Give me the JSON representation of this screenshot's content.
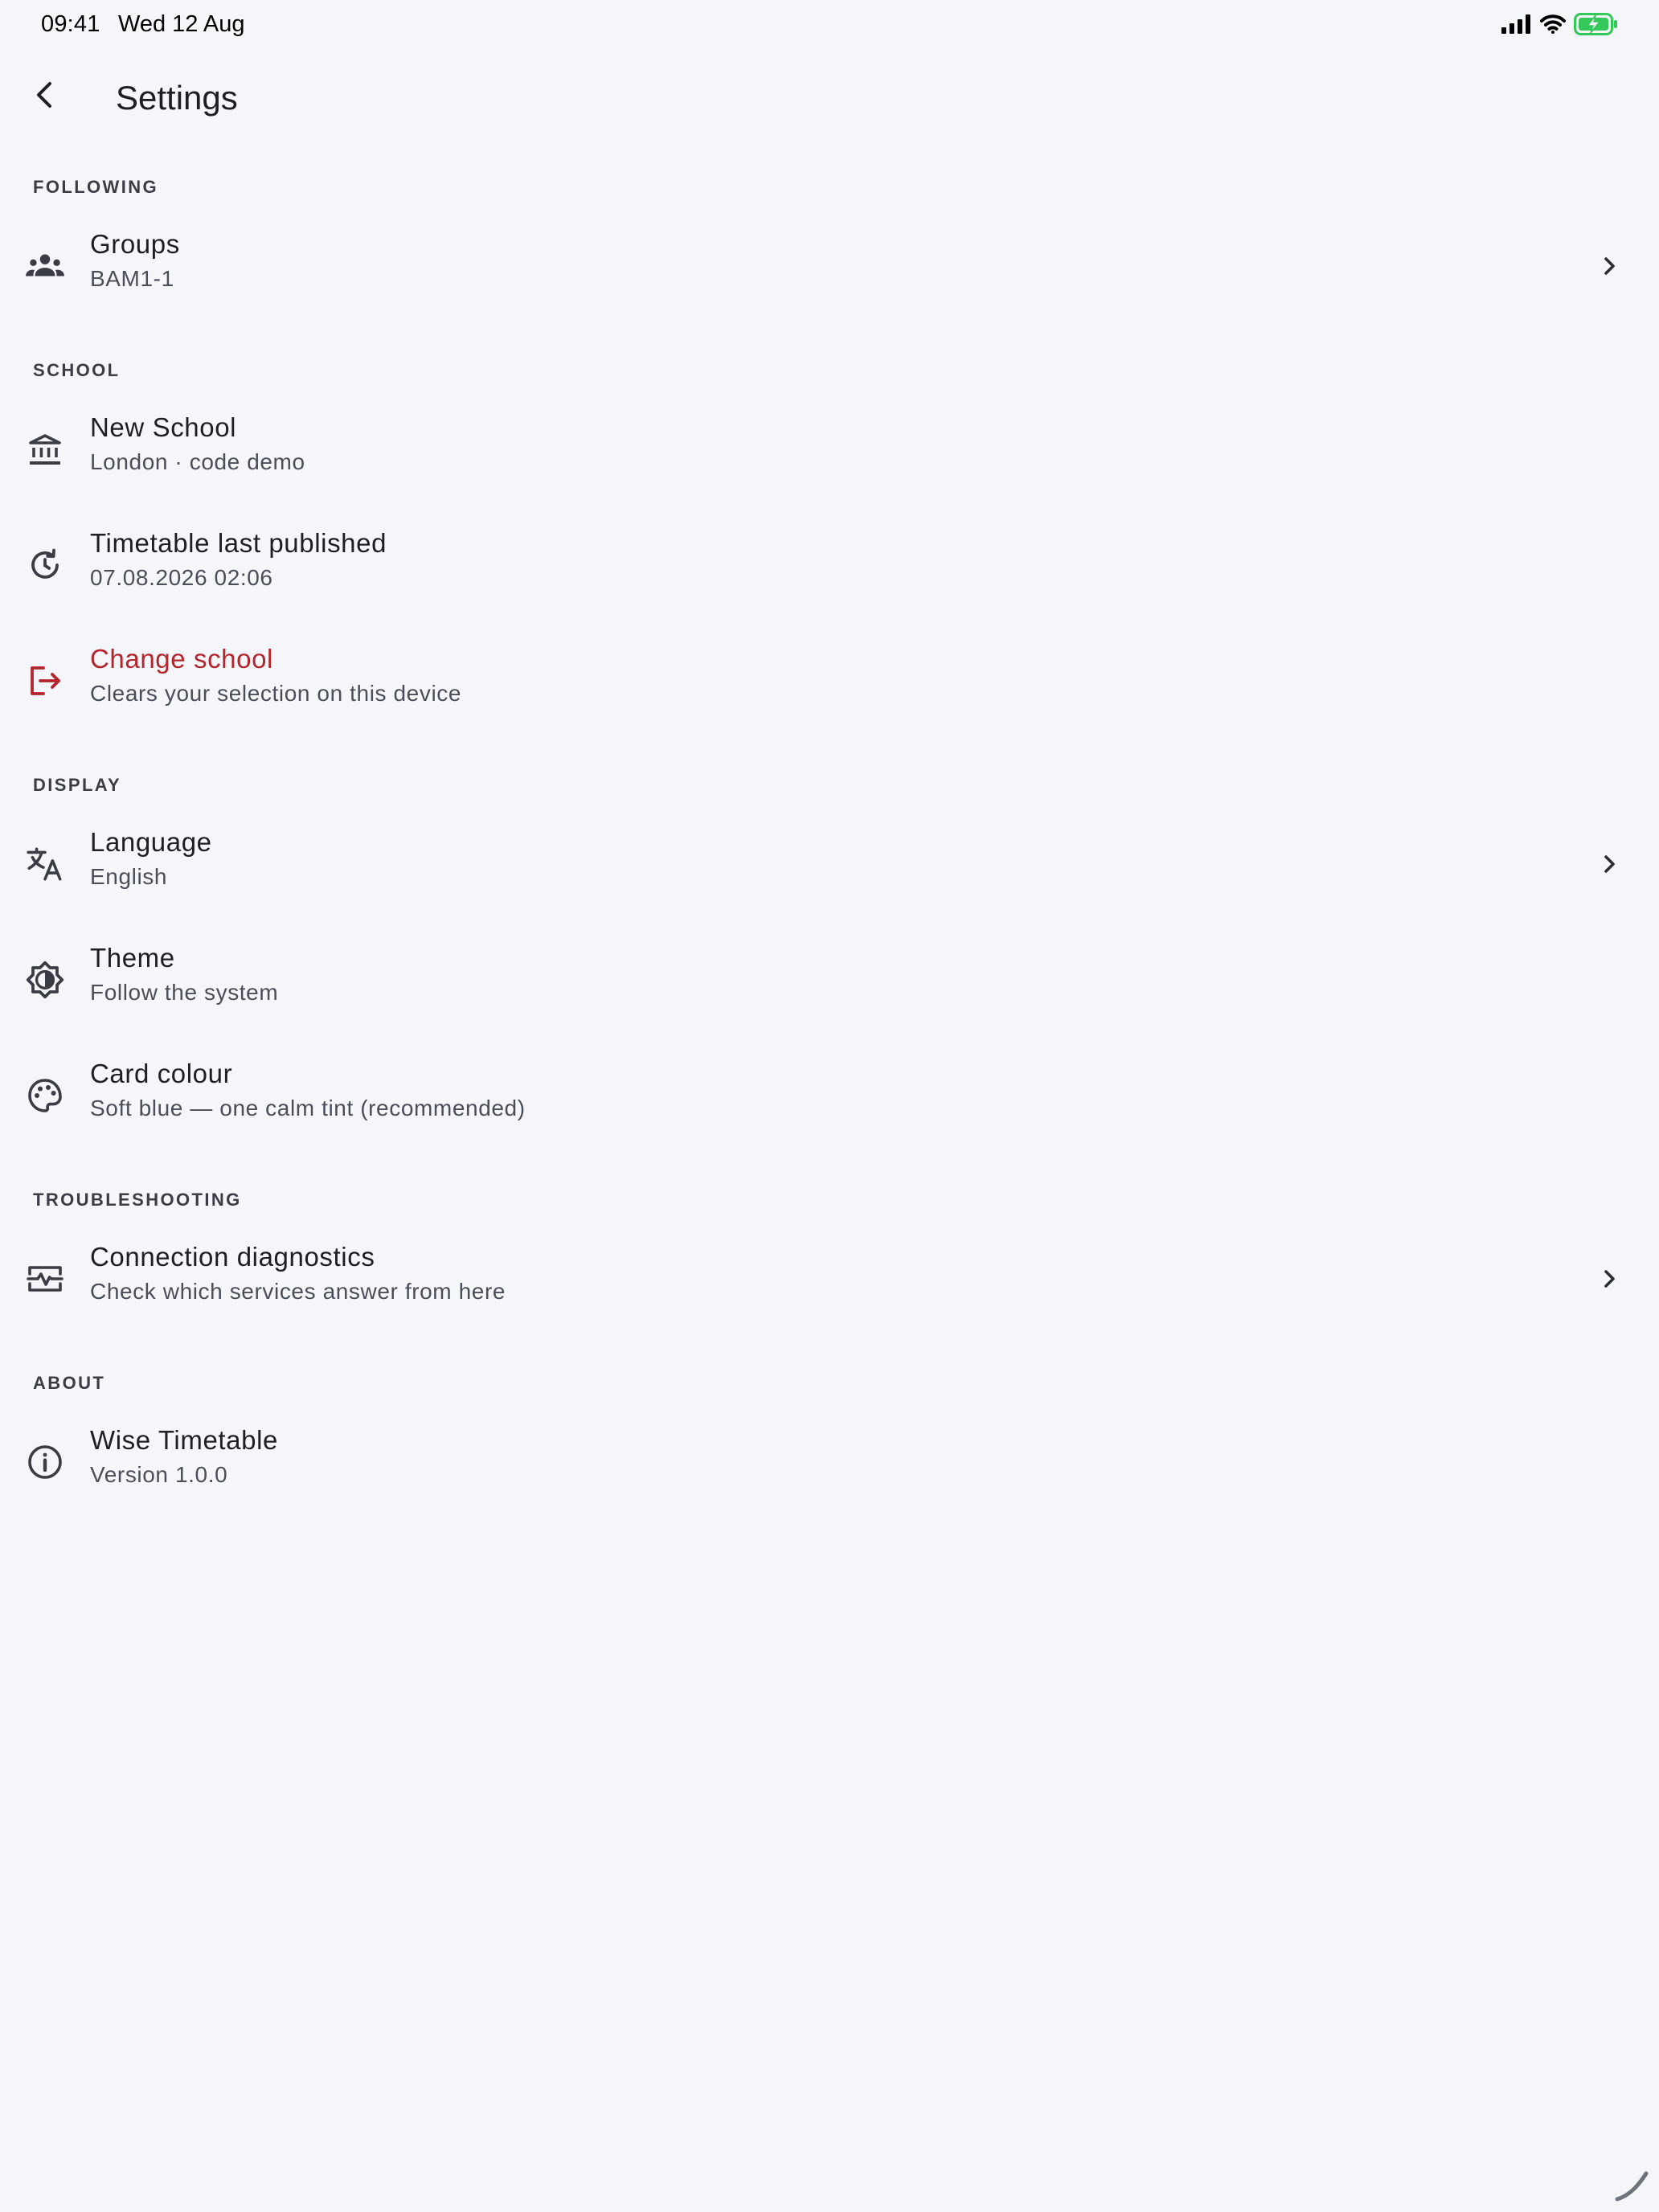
{
  "status_bar": {
    "time": "09:41",
    "date": "Wed 12 Aug",
    "icons": [
      "signal-icon",
      "wifi-icon",
      "battery-charging-icon"
    ]
  },
  "app_bar": {
    "back_icon": "chevron-left-icon",
    "title": "Settings"
  },
  "sections": {
    "following": {
      "header": "FOLLOWING",
      "groups": {
        "icon": "groups-icon",
        "title": "Groups",
        "subtitle": "BAM1-1",
        "trailing": "chevron-right-icon"
      }
    },
    "school": {
      "header": "SCHOOL",
      "school": {
        "icon": "school-building-icon",
        "title": "New School",
        "subtitle": "London · code demo"
      },
      "timetable": {
        "icon": "history-icon",
        "title": "Timetable last published",
        "subtitle": "07.08.2026 02:06"
      },
      "change": {
        "icon": "logout-icon",
        "title": "Change school",
        "subtitle": "Clears your selection on this device"
      }
    },
    "display": {
      "header": "DISPLAY",
      "language": {
        "icon": "translate-icon",
        "title": "Language",
        "subtitle": "English",
        "trailing": "chevron-right-icon"
      },
      "theme": {
        "icon": "brightness-icon",
        "title": "Theme",
        "subtitle": "Follow the system"
      },
      "card_colour": {
        "icon": "palette-icon",
        "title": "Card colour",
        "subtitle": "Soft blue — one calm tint (recommended)"
      }
    },
    "troubleshooting": {
      "header": "TROUBLESHOOTING",
      "diagnostics": {
        "icon": "monitor-heart-icon",
        "title": "Connection diagnostics",
        "subtitle": "Check which services answer from here",
        "trailing": "chevron-right-icon"
      }
    },
    "about": {
      "header": "ABOUT",
      "app": {
        "icon": "info-icon",
        "title": "Wise Timetable",
        "subtitle": "Version 1.0.0"
      }
    }
  },
  "colors": {
    "background": "#f5f6fa",
    "text": "#1d1f24",
    "subtext": "#4a4e57",
    "danger": "#b3262d",
    "battery": "#34c759"
  }
}
